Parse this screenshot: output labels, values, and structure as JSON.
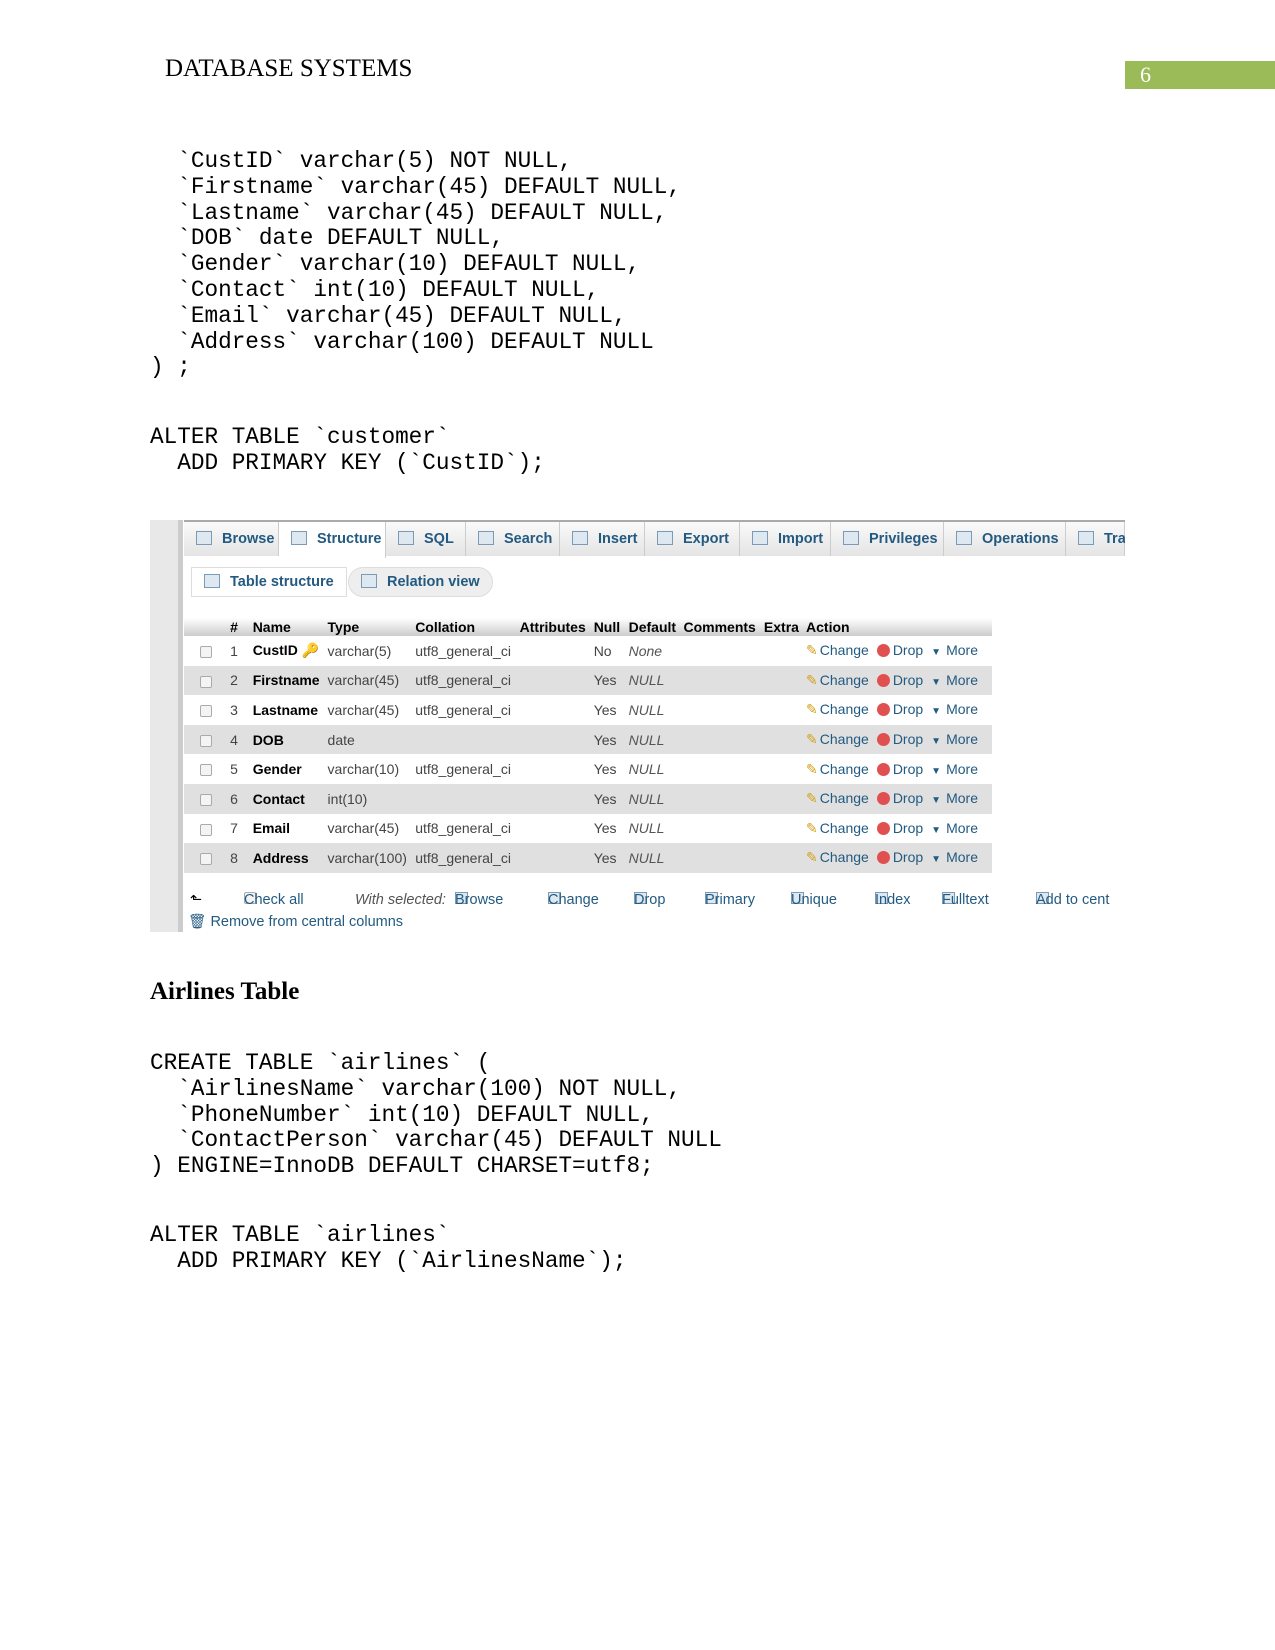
{
  "header": {
    "title": "DATABASE SYSTEMS",
    "page_number": "6"
  },
  "code_block_1": "  `CustID` varchar(5) NOT NULL,\n  `Firstname` varchar(45) DEFAULT NULL,\n  `Lastname` varchar(45) DEFAULT NULL,\n  `DOB` date DEFAULT NULL,\n  `Gender` varchar(10) DEFAULT NULL,\n  `Contact` int(10) DEFAULT NULL,\n  `Email` varchar(45) DEFAULT NULL,\n  `Address` varchar(100) DEFAULT NULL\n) ;",
  "code_block_2": "ALTER TABLE `customer`\n  ADD PRIMARY KEY (`CustID`);",
  "screenshot": {
    "tabs": [
      "Browse",
      "Structure",
      "SQL",
      "Search",
      "Insert",
      "Export",
      "Import",
      "Privileges",
      "Operations",
      "Tra"
    ],
    "active_tab": "Structure",
    "subtabs": [
      "Table structure",
      "Relation view"
    ],
    "columns": [
      "#",
      "Name",
      "Type",
      "Collation",
      "Attributes",
      "Null",
      "Default",
      "Comments",
      "Extra",
      "Action"
    ],
    "rows": [
      {
        "n": "1",
        "name": "CustID",
        "type": "varchar(5)",
        "collation": "utf8_general_ci",
        "null": "No",
        "default": "None",
        "primary": true
      },
      {
        "n": "2",
        "name": "Firstname",
        "type": "varchar(45)",
        "collation": "utf8_general_ci",
        "null": "Yes",
        "default": "NULL"
      },
      {
        "n": "3",
        "name": "Lastname",
        "type": "varchar(45)",
        "collation": "utf8_general_ci",
        "null": "Yes",
        "default": "NULL"
      },
      {
        "n": "4",
        "name": "DOB",
        "type": "date",
        "collation": "",
        "null": "Yes",
        "default": "NULL"
      },
      {
        "n": "5",
        "name": "Gender",
        "type": "varchar(10)",
        "collation": "utf8_general_ci",
        "null": "Yes",
        "default": "NULL"
      },
      {
        "n": "6",
        "name": "Contact",
        "type": "int(10)",
        "collation": "",
        "null": "Yes",
        "default": "NULL"
      },
      {
        "n": "7",
        "name": "Email",
        "type": "varchar(45)",
        "collation": "utf8_general_ci",
        "null": "Yes",
        "default": "NULL"
      },
      {
        "n": "8",
        "name": "Address",
        "type": "varchar(100)",
        "collation": "utf8_general_ci",
        "null": "Yes",
        "default": "NULL"
      }
    ],
    "row_actions": {
      "change": "Change",
      "drop": "Drop",
      "more": "More"
    },
    "footer": {
      "check_all": "Check all",
      "with_selected": "With selected:",
      "actions": [
        "Browse",
        "Change",
        "Drop",
        "Primary",
        "Unique",
        "Index",
        "Fulltext",
        "Add to cent"
      ],
      "remove": "Remove from central columns"
    }
  },
  "section_title": "Airlines Table",
  "code_block_3": "CREATE TABLE `airlines` (\n  `AirlinesName` varchar(100) NOT NULL,\n  `PhoneNumber` int(10) DEFAULT NULL,\n  `ContactPerson` varchar(45) DEFAULT NULL\n) ENGINE=InnoDB DEFAULT CHARSET=utf8;",
  "code_block_4": "ALTER TABLE `airlines`\n  ADD PRIMARY KEY (`AirlinesName`);"
}
